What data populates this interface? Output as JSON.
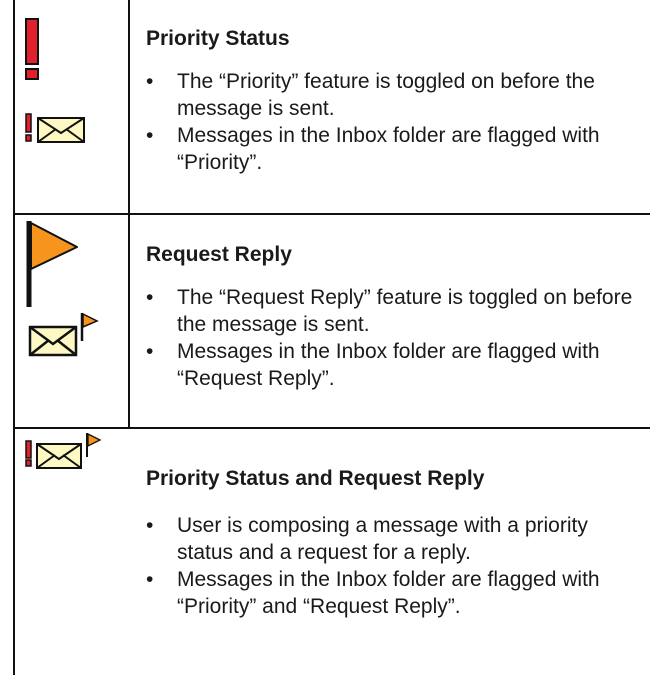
{
  "rows": [
    {
      "title": "Priority Status",
      "icons": [
        "priority-exclamation-large",
        "priority-envelope-small"
      ],
      "bullets": [
        "The “Priority” feature is toggled on before the message is sent.",
        "Messages in the Inbox folder are flagged with “Priority”."
      ]
    },
    {
      "title": "Request Reply",
      "icons": [
        "request-reply-flag-large",
        "request-reply-envelope-small"
      ],
      "bullets": [
        "The “Request Reply” feature is toggled on before the message is sent.",
        "Messages in the Inbox folder are flagged with “Request Reply”."
      ]
    },
    {
      "title": "Priority Status and Request Reply",
      "icons": [
        "priority-request-reply-envelope"
      ],
      "bullets": [
        "User is composing a message with a priority status and a request for a reply.",
        "Messages in the Inbox folder are flagged with “Priority” and “Request Reply”."
      ]
    }
  ],
  "colors": {
    "priority_red": "#e0202a",
    "flag_orange": "#f7941d",
    "envelope_fill": "#fef9c3",
    "border": "#111111"
  }
}
